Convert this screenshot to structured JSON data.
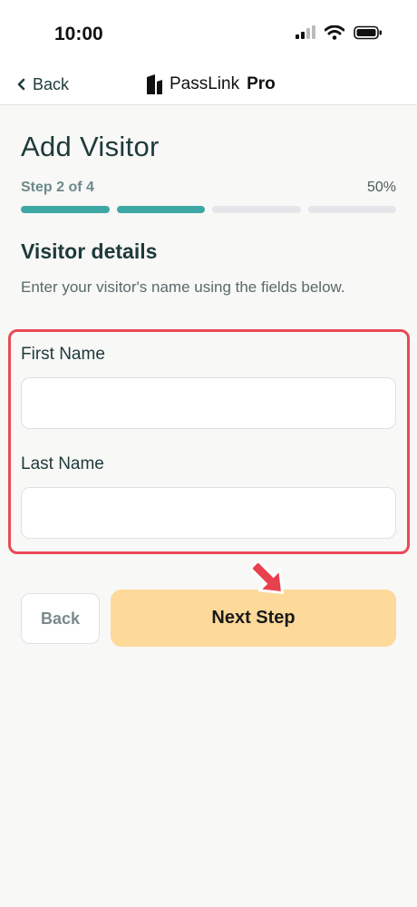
{
  "status_bar": {
    "time": "10:00",
    "icons": [
      "signal-icon",
      "wifi-icon",
      "battery-icon"
    ]
  },
  "nav": {
    "back_label": "Back",
    "brand_prefix": "PassLink",
    "brand_suffix": "Pro",
    "brand_icon": "passlink-logo-icon"
  },
  "page": {
    "title": "Add Visitor"
  },
  "progress": {
    "step_label": "Step 2 of 4",
    "percent_label": "50%",
    "steps_total": 4,
    "steps_completed": 2,
    "fraction": 0.5,
    "active_color": "#3ea8a4",
    "inactive_color": "#e6e6ea"
  },
  "section": {
    "title": "Visitor details",
    "description": "Enter your visitor's name using the fields below."
  },
  "form": {
    "first_name": {
      "label": "First Name",
      "value": "",
      "placeholder": ""
    },
    "last_name": {
      "label": "Last Name",
      "value": "",
      "placeholder": ""
    }
  },
  "actions": {
    "back_label": "Back",
    "next_label": "Next Step",
    "next_color": "#fdd99a"
  },
  "annotation": {
    "highlight_color": "#e84a55",
    "arrow_icon": "pointer-arrow-icon"
  }
}
